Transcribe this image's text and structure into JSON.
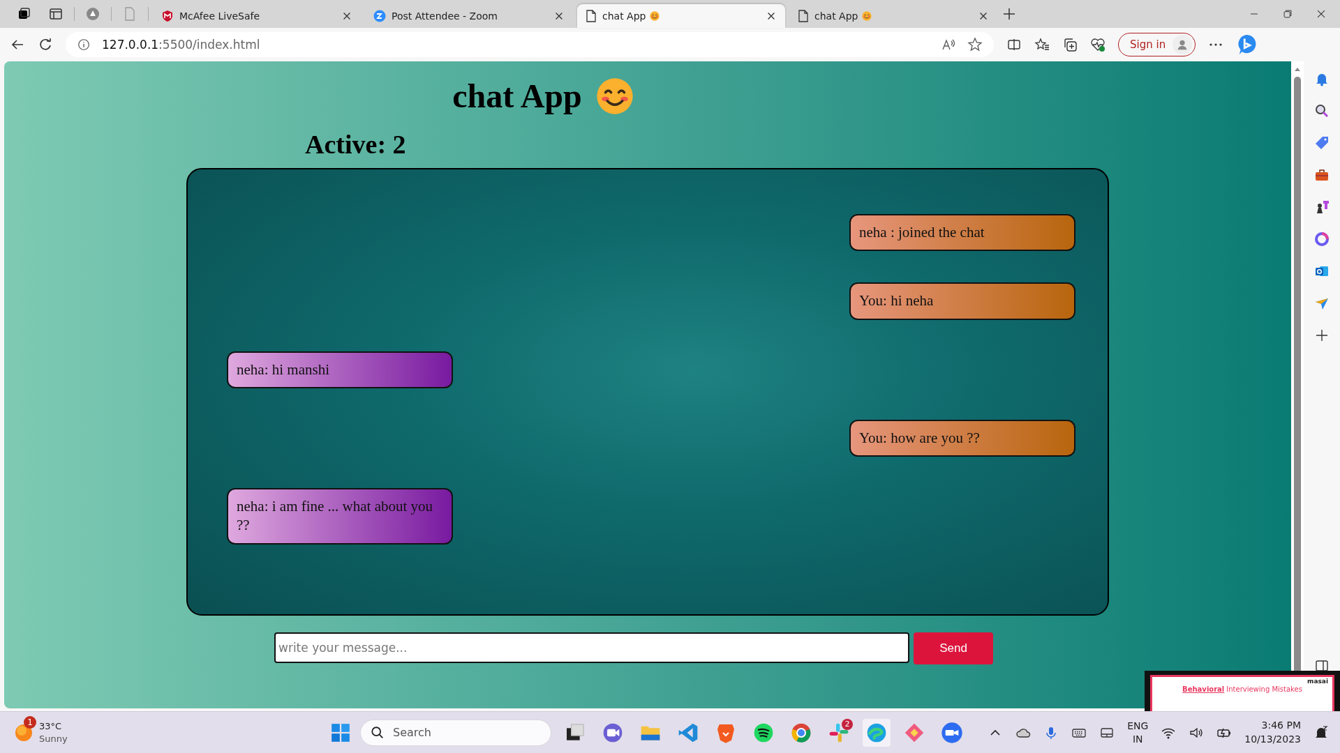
{
  "browser": {
    "tabs": [
      {
        "title": "McAfee LiveSafe",
        "kind": "shield",
        "selected": false
      },
      {
        "title": "Post Attendee - Zoom",
        "kind": "video",
        "selected": false
      },
      {
        "title": "chat App",
        "kind": "page",
        "selected": true
      },
      {
        "title": "chat App",
        "kind": "page",
        "selected": false
      }
    ],
    "address": {
      "host": "127.0.0.1",
      "rest": ":5500/index.html"
    },
    "sign_in": "Sign in"
  },
  "page": {
    "title": "chat App",
    "active": "Active: 2",
    "messages": [
      {
        "kind": "outgoing",
        "text": "neha : joined the chat"
      },
      {
        "kind": "outgoing",
        "text": "You: hi neha"
      },
      {
        "kind": "incoming",
        "text": "neha: hi manshi"
      },
      {
        "kind": "outgoing",
        "text": "You: how are you ??"
      },
      {
        "kind": "incoming",
        "text": "neha: i am fine ... what about you ??"
      }
    ],
    "input": {
      "placeholder": "write your message..."
    },
    "send": "Send"
  },
  "video_overlay": {
    "brand": "masai",
    "heading_highlight": "Behavioral",
    "heading_rest": "Interviewing Mistakes"
  },
  "taskbar": {
    "weather": {
      "badge": "1",
      "temperature": "33°C",
      "condition": "Sunny"
    },
    "search": {
      "placeholder": "Search"
    },
    "slack_badge": "2",
    "language": {
      "line1": "ENG",
      "line2": "IN"
    },
    "time": "3:46 PM",
    "date": "10/13/2023"
  }
}
